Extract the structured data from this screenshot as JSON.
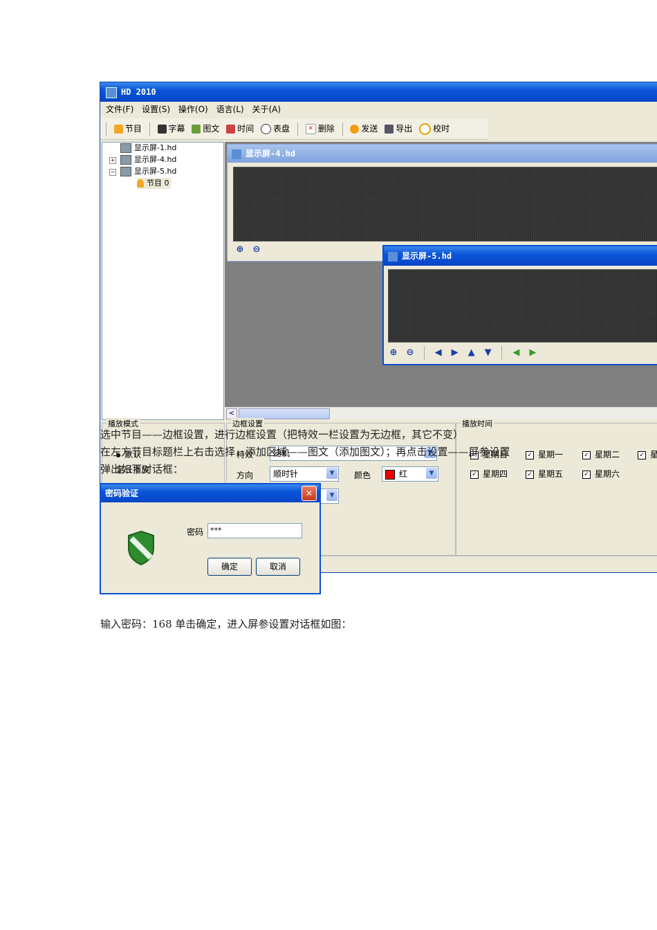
{
  "app": {
    "title": "HD 2010",
    "menu": [
      "文件(F)",
      "设置(S)",
      "操作(O)",
      "语言(L)",
      "关于(A)"
    ],
    "toolbar": [
      "节目",
      "字幕",
      "图文",
      "时间",
      "表盘",
      "删除",
      "发送",
      "导出",
      "校时"
    ]
  },
  "tree": {
    "items": [
      "显示屏-1.hd",
      "显示屏-4.hd",
      "显示屏-5.hd",
      "节目 0"
    ]
  },
  "windows": {
    "child4_title": "显示屏-4.hd",
    "child5_title": "显示屏-5.hd",
    "close_glyph": "✕"
  },
  "panels": {
    "play_mode_label": "播放模式",
    "play_default": "默认",
    "play_fixed": "定长播放",
    "border_label": "边框设置",
    "effect_label": "特效",
    "effect_value": "随机",
    "direction_label": "方向",
    "direction_value": "顺时针",
    "color_label": "颜色",
    "color_value": "红",
    "play_time_label": "播放时间",
    "days": [
      "星期日",
      "星期一",
      "星期二",
      "星",
      "星期四",
      "星期五",
      "星期六"
    ]
  },
  "doc": {
    "line1": "选中节目——边框设置，进行边框设置（把特效一栏设置为无边框，其它不变）",
    "line2": "在左方节目标题栏上右击选择，添加区域——图文（添加图文）；再点击设置——屏参设置",
    "line3": "弹出如下对话框：",
    "line4": "输入密码：168 单击确定，进入屏参设置对话框如图："
  },
  "password_dialog": {
    "title": "密码验证",
    "label": "密码",
    "value": "***",
    "ok": "确定",
    "cancel": "取消"
  },
  "colors": {
    "xp_blue": "#0a55d8",
    "close_red": "#c83818",
    "led_bg": "#2a2a2a"
  }
}
